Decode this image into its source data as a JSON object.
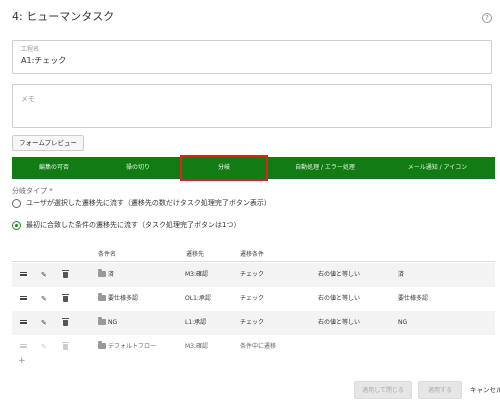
{
  "header": {
    "title": "4: ヒューマンタスク",
    "help_icon": "?"
  },
  "form": {
    "step_label": "工程名",
    "step_value": "A1:チェック",
    "memo_placeholder": "メモ",
    "preview_button": "フォームプレビュー"
  },
  "tabs": [
    {
      "label": "編集の可否"
    },
    {
      "label": "操の切り"
    },
    {
      "label": "分岐",
      "active": true
    },
    {
      "label": "自動処理 / エラー処理"
    },
    {
      "label": "メール通知 / アイコン"
    }
  ],
  "branch": {
    "type_label": "分岐タイプ *",
    "option1": "ユーザが選択した遷移先に流す（遷移先の数だけタスク処理完了ボタン表示）",
    "option2": "最初に合致した条件の遷移先に流す（タスク処理完了ボタンは1つ）",
    "selected": 2
  },
  "table": {
    "headers": {
      "condition_name": "条件名",
      "destination": "遷移先",
      "condition": "遷移条件"
    },
    "rows": [
      {
        "name": "済",
        "dest": "M3:確認",
        "field": "チェック",
        "op": "右の値と等しい",
        "value": "済"
      },
      {
        "name": "要仕様多認",
        "dest": "OL1:承認",
        "field": "チェック",
        "op": "右の値と等しい",
        "value": "要仕様多認"
      },
      {
        "name": "NG",
        "dest": "L1:承認",
        "field": "チェック",
        "op": "右の値と等しい",
        "value": "NG"
      },
      {
        "name": "デフォルトフロー",
        "dest": "M3:確認",
        "field": "条件中に遷移",
        "op": "",
        "value": "",
        "disabled": true
      }
    ],
    "add_symbol": "+"
  },
  "footer": {
    "apply_close": "適用して閉じる",
    "apply": "適用する",
    "cancel": "キャンセル"
  },
  "colors": {
    "tab_bar": "#137b13",
    "tab_highlight": "#e21e1e",
    "radio_selected": "#1a8a1a"
  }
}
